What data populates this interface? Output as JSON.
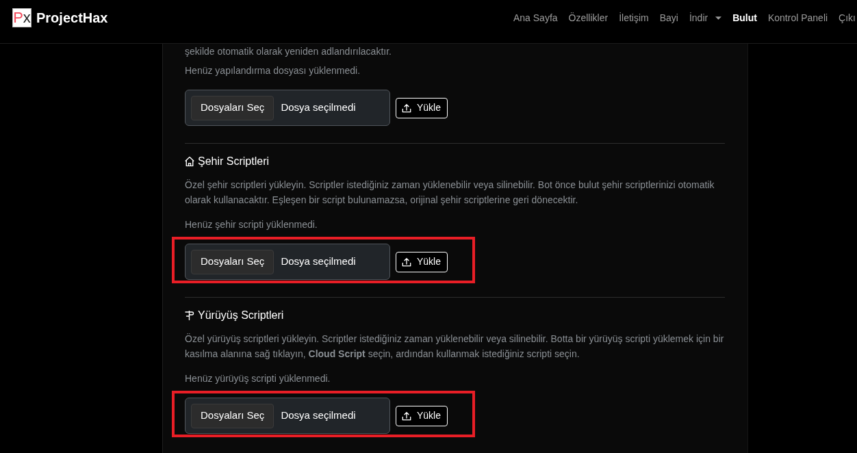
{
  "navbar": {
    "logo": [
      {
        "text": "P",
        "color": "#f2495a"
      },
      {
        "text": "x",
        "color": "#1e1e1e"
      }
    ],
    "brand": "ProjectHax",
    "links": [
      {
        "label": "Ana Sayfa",
        "kind": "link",
        "selected": false
      },
      {
        "label": "Özellikler",
        "kind": "link",
        "selected": false
      },
      {
        "label": "İletişim",
        "kind": "link",
        "selected": false
      },
      {
        "label": "Bayi",
        "kind": "link",
        "selected": false
      },
      {
        "label": "İndir",
        "kind": "dropdown",
        "selected": false
      },
      {
        "label": "Bulut",
        "kind": "link",
        "selected": true
      },
      {
        "label": "Kontrol Paneli",
        "kind": "link",
        "selected": false
      },
      {
        "label": "Çıkı",
        "kind": "link",
        "selected": false
      }
    ]
  },
  "sections": [
    {
      "kind": "config",
      "description": "şekilde otomatik olarak yeniden adlandırılacaktır.",
      "status": "Henüz yapılandırma dosyası yüklenmedi.",
      "upload": {
        "choose_button": "Dosyaları Seç",
        "file_status": "Dosya seçilmedi",
        "upload_button": "Yükle"
      },
      "highlighted": false
    },
    {
      "kind": "city",
      "title": "Şehir Scriptleri",
      "description": "Özel şehir scriptleri yükleyin. Scriptler istediğiniz zaman yüklenebilir veya silinebilir. Bot önce bulut şehir scriptlerinizi otomatik olarak kullanacaktır. Eşleşen bir script bulunamazsa, orijinal şehir scriptlerine geri dönecektir.",
      "status": "Henüz şehir scripti yüklenmedi.",
      "upload": {
        "choose_button": "Dosyaları Seç",
        "file_status": "Dosya seçilmedi",
        "upload_button": "Yükle"
      },
      "highlighted": true
    },
    {
      "kind": "walk",
      "title": "Yürüyüş Scriptleri",
      "description": "Özel yürüyüş scriptleri yükleyin. Scriptler istediğiniz zaman yüklenebilir veya silinebilir. Botta bir yürüyüş scripti yüklemek için bir kasılma alanına sağ tıklayın, **Cloud Script** seçin, ardından kullanmak istediğiniz scripti seçin.",
      "status": "Henüz yürüyüş scripti yüklenmedi.",
      "upload": {
        "choose_button": "Dosyaları Seç",
        "file_status": "Dosya seçilmedi",
        "upload_button": "Yükle"
      },
      "highlighted": true
    }
  ]
}
